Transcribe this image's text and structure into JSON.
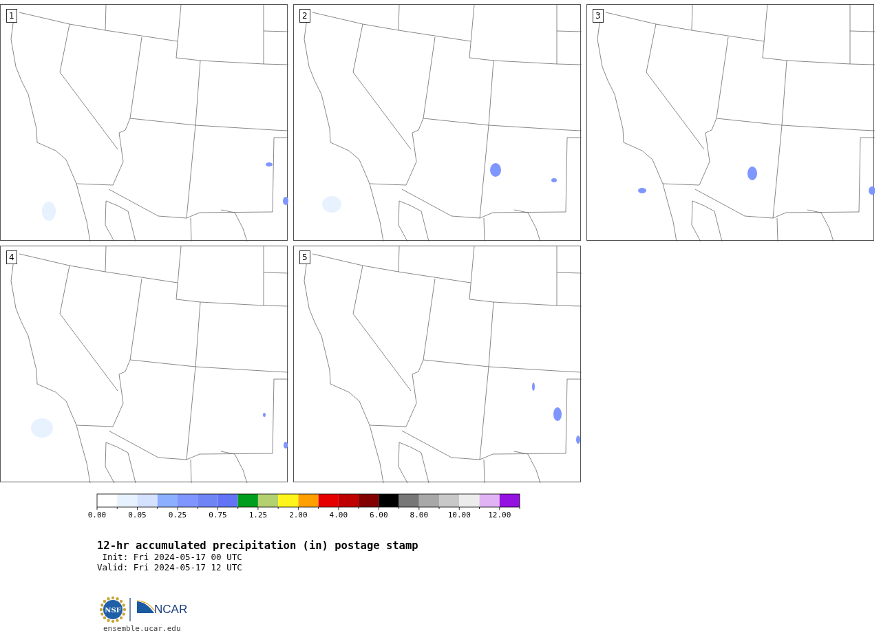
{
  "panels": [
    {
      "label": "1"
    },
    {
      "label": "2"
    },
    {
      "label": "3"
    },
    {
      "label": "4"
    },
    {
      "label": "5"
    }
  ],
  "colorbar": {
    "segments": [
      {
        "color": "#ffffff"
      },
      {
        "color": "#e8f2ff"
      },
      {
        "color": "#d4e1ff"
      },
      {
        "color": "#8cb0ff"
      },
      {
        "color": "#7f96ff"
      },
      {
        "color": "#7085f5"
      },
      {
        "color": "#6373f5"
      },
      {
        "color": "#009e1e"
      },
      {
        "color": "#b3d16e"
      },
      {
        "color": "#fff51b"
      },
      {
        "color": "#ffa000"
      },
      {
        "color": "#e60000"
      },
      {
        "color": "#be0000"
      },
      {
        "color": "#820000"
      },
      {
        "color": "#000000"
      },
      {
        "color": "#777777"
      },
      {
        "color": "#a8a8a8"
      },
      {
        "color": "#c8c8c8"
      },
      {
        "color": "#ececec"
      },
      {
        "color": "#e1b3f5"
      },
      {
        "color": "#9413e1"
      }
    ],
    "ticks": [
      {
        "label": "0.00"
      },
      {
        "label": "0.05"
      },
      {
        "label": "0.25"
      },
      {
        "label": "0.75"
      },
      {
        "label": "1.25"
      },
      {
        "label": "2.00"
      },
      {
        "label": "4.00"
      },
      {
        "label": "6.00"
      },
      {
        "label": "8.00"
      },
      {
        "label": "10.00"
      },
      {
        "label": "12.00"
      }
    ]
  },
  "title": "12-hr accumulated precipitation (in) postage stamp",
  "init": " Init: Fri 2024-05-17 00 UTC",
  "valid": "Valid: Fri 2024-05-17 12 UTC",
  "logo": {
    "left_text": "NSF",
    "right_text": "NCAR"
  },
  "url": "ensemble.ucar.edu"
}
